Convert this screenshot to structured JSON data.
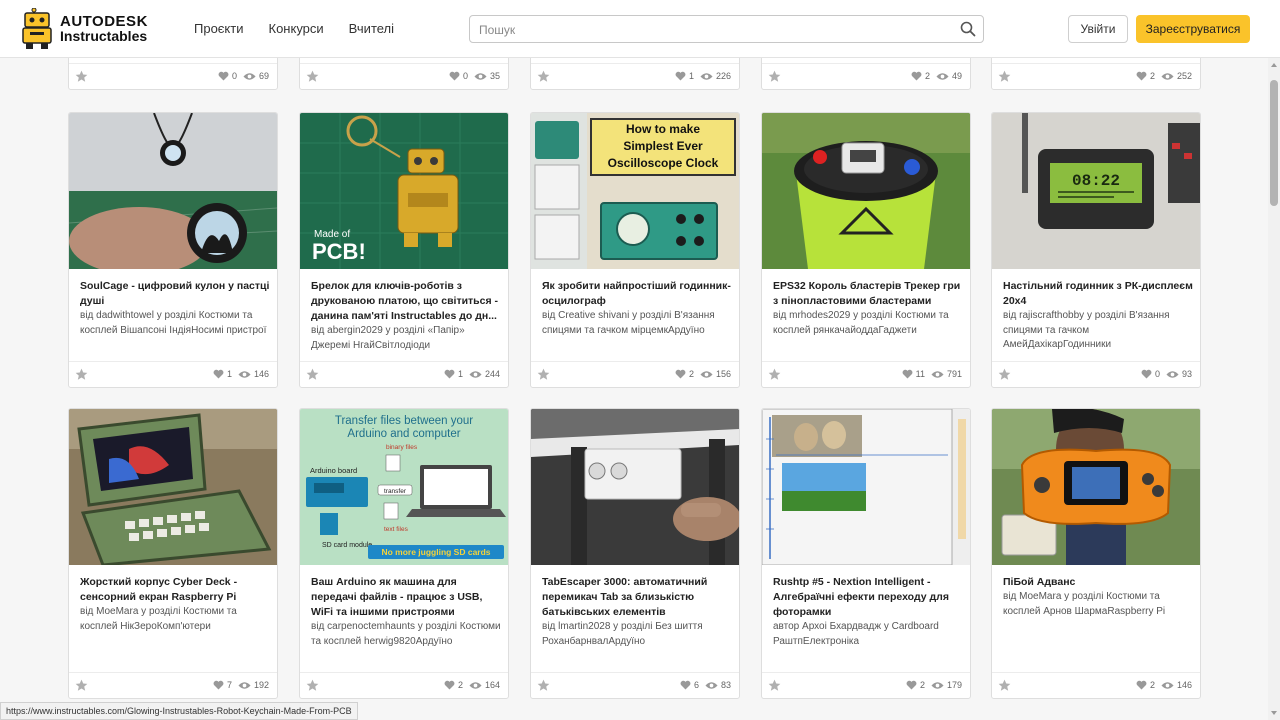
{
  "header": {
    "logo_line1": "AUTODESK",
    "logo_line2": "Instructables",
    "nav": [
      "Проєкти",
      "Конкурси",
      "Вчителі"
    ],
    "search_placeholder": "Пошук",
    "login_label": "Увійти",
    "signup_label": "Зареєструватися",
    "signup_color": "#fac32a"
  },
  "top_row": [
    {
      "likes": "0",
      "views": "69"
    },
    {
      "likes": "0",
      "views": "35"
    },
    {
      "likes": "1",
      "views": "226"
    },
    {
      "likes": "2",
      "views": "49"
    },
    {
      "likes": "2",
      "views": "252"
    }
  ],
  "row1": [
    {
      "title": "SoulCage - цифровий кулон у пастці душі",
      "meta": "від dadwithtowel у розділі Костюми та косплей Вішапсоні ІндіяНосимі пристрої",
      "likes": "1",
      "views": "146",
      "image": "soulcage-pendant-image"
    },
    {
      "title": "Брелок для ключів-роботів з друкованою платою, що світиться - данина пам'яті Instructables до дн...",
      "meta": "від abergin2029 у розділі «Папір» Джеремі НгайСвітлодіоди",
      "likes": "1",
      "views": "244",
      "image": "pcb-robot-keychain-image",
      "overlay1": "Made of",
      "overlay2": "PCB!"
    },
    {
      "title": "Як зробити найпростіший годинник-осцилограф",
      "meta": "від Creative shivani у розділі В'язання спицями та гачком мірцемкАрдуїно",
      "likes": "2",
      "views": "156",
      "image": "oscilloscope-clock-image",
      "overlay1": "How to make",
      "overlay2": "Simplest Ever",
      "overlay3": "Oscilloscope Clock"
    },
    {
      "title": "EPS32 Король бластерів Трекер гри з пінопластовими бластерами",
      "meta": "від mrhodes2029 у розділі Костюми та косплей рянкачайоддаГаджети",
      "likes": "11",
      "views": "791",
      "image": "blaster-tracker-bucket-image"
    },
    {
      "title": "Настільний годинник з РК-дисплеєм 20x4",
      "meta": "від rajiscrafthobby у розділі В'язання спицями та гачком АмейДахікарГодинники",
      "likes": "0",
      "views": "93",
      "image": "lcd-desk-clock-image",
      "overlay1": "08:22"
    }
  ],
  "row2": [
    {
      "title": "Жорсткий корпус Cyber Deck - сенсорний екран Raspberry Pi",
      "meta": "від MoeMara у розділі Костюми та косплей НікЗероКомп'ютери",
      "likes": "7",
      "views": "192",
      "image": "cyber-deck-case-image"
    },
    {
      "title": "Ваш Arduino як машина для передачі файлів - працює з USB, WiFi та іншими пристроями",
      "meta": "від carpenoctemhaunts у розділі Костюми та косплей herwig9820Ардуїно",
      "likes": "2",
      "views": "164",
      "image": "arduino-file-transfer-image",
      "overlay1": "Transfer files between your",
      "overlay2": "Arduino and computer",
      "overlay3": "Arduino board",
      "overlay4": "binary files",
      "overlay5": "transfer",
      "overlay6": "text files",
      "overlay7": "SD card module",
      "overlay8": "No more juggling SD cards"
    },
    {
      "title": "TabEscaper 3000: автоматичний перемикач Tab за близькістю батьківських елементів",
      "meta": "від lmartin2028 у розділі Без шиття РоханбарнвалАрдуїно",
      "likes": "6",
      "views": "83",
      "image": "tabescaper-sensor-image"
    },
    {
      "title": "Rushtp #5 - Nextion Intelligent - Алгебраїчні ефекти переходу для фоторамки",
      "meta": "автор Архоі Бхардвадж у Cardboard РаштпЕлектроніка",
      "likes": "2",
      "views": "179",
      "image": "nextion-photo-frame-image"
    },
    {
      "title": "ПіБой Адванс",
      "meta": "від MoeMara у розділі Костюми та косплей Арнов ШармаRaspberry Pi",
      "likes": "2",
      "views": "146",
      "image": "piboy-advance-image"
    }
  ],
  "status_url": "https://www.instructables.com/Glowing-Instrustables-Robot-Keychain-Made-From-PCB"
}
